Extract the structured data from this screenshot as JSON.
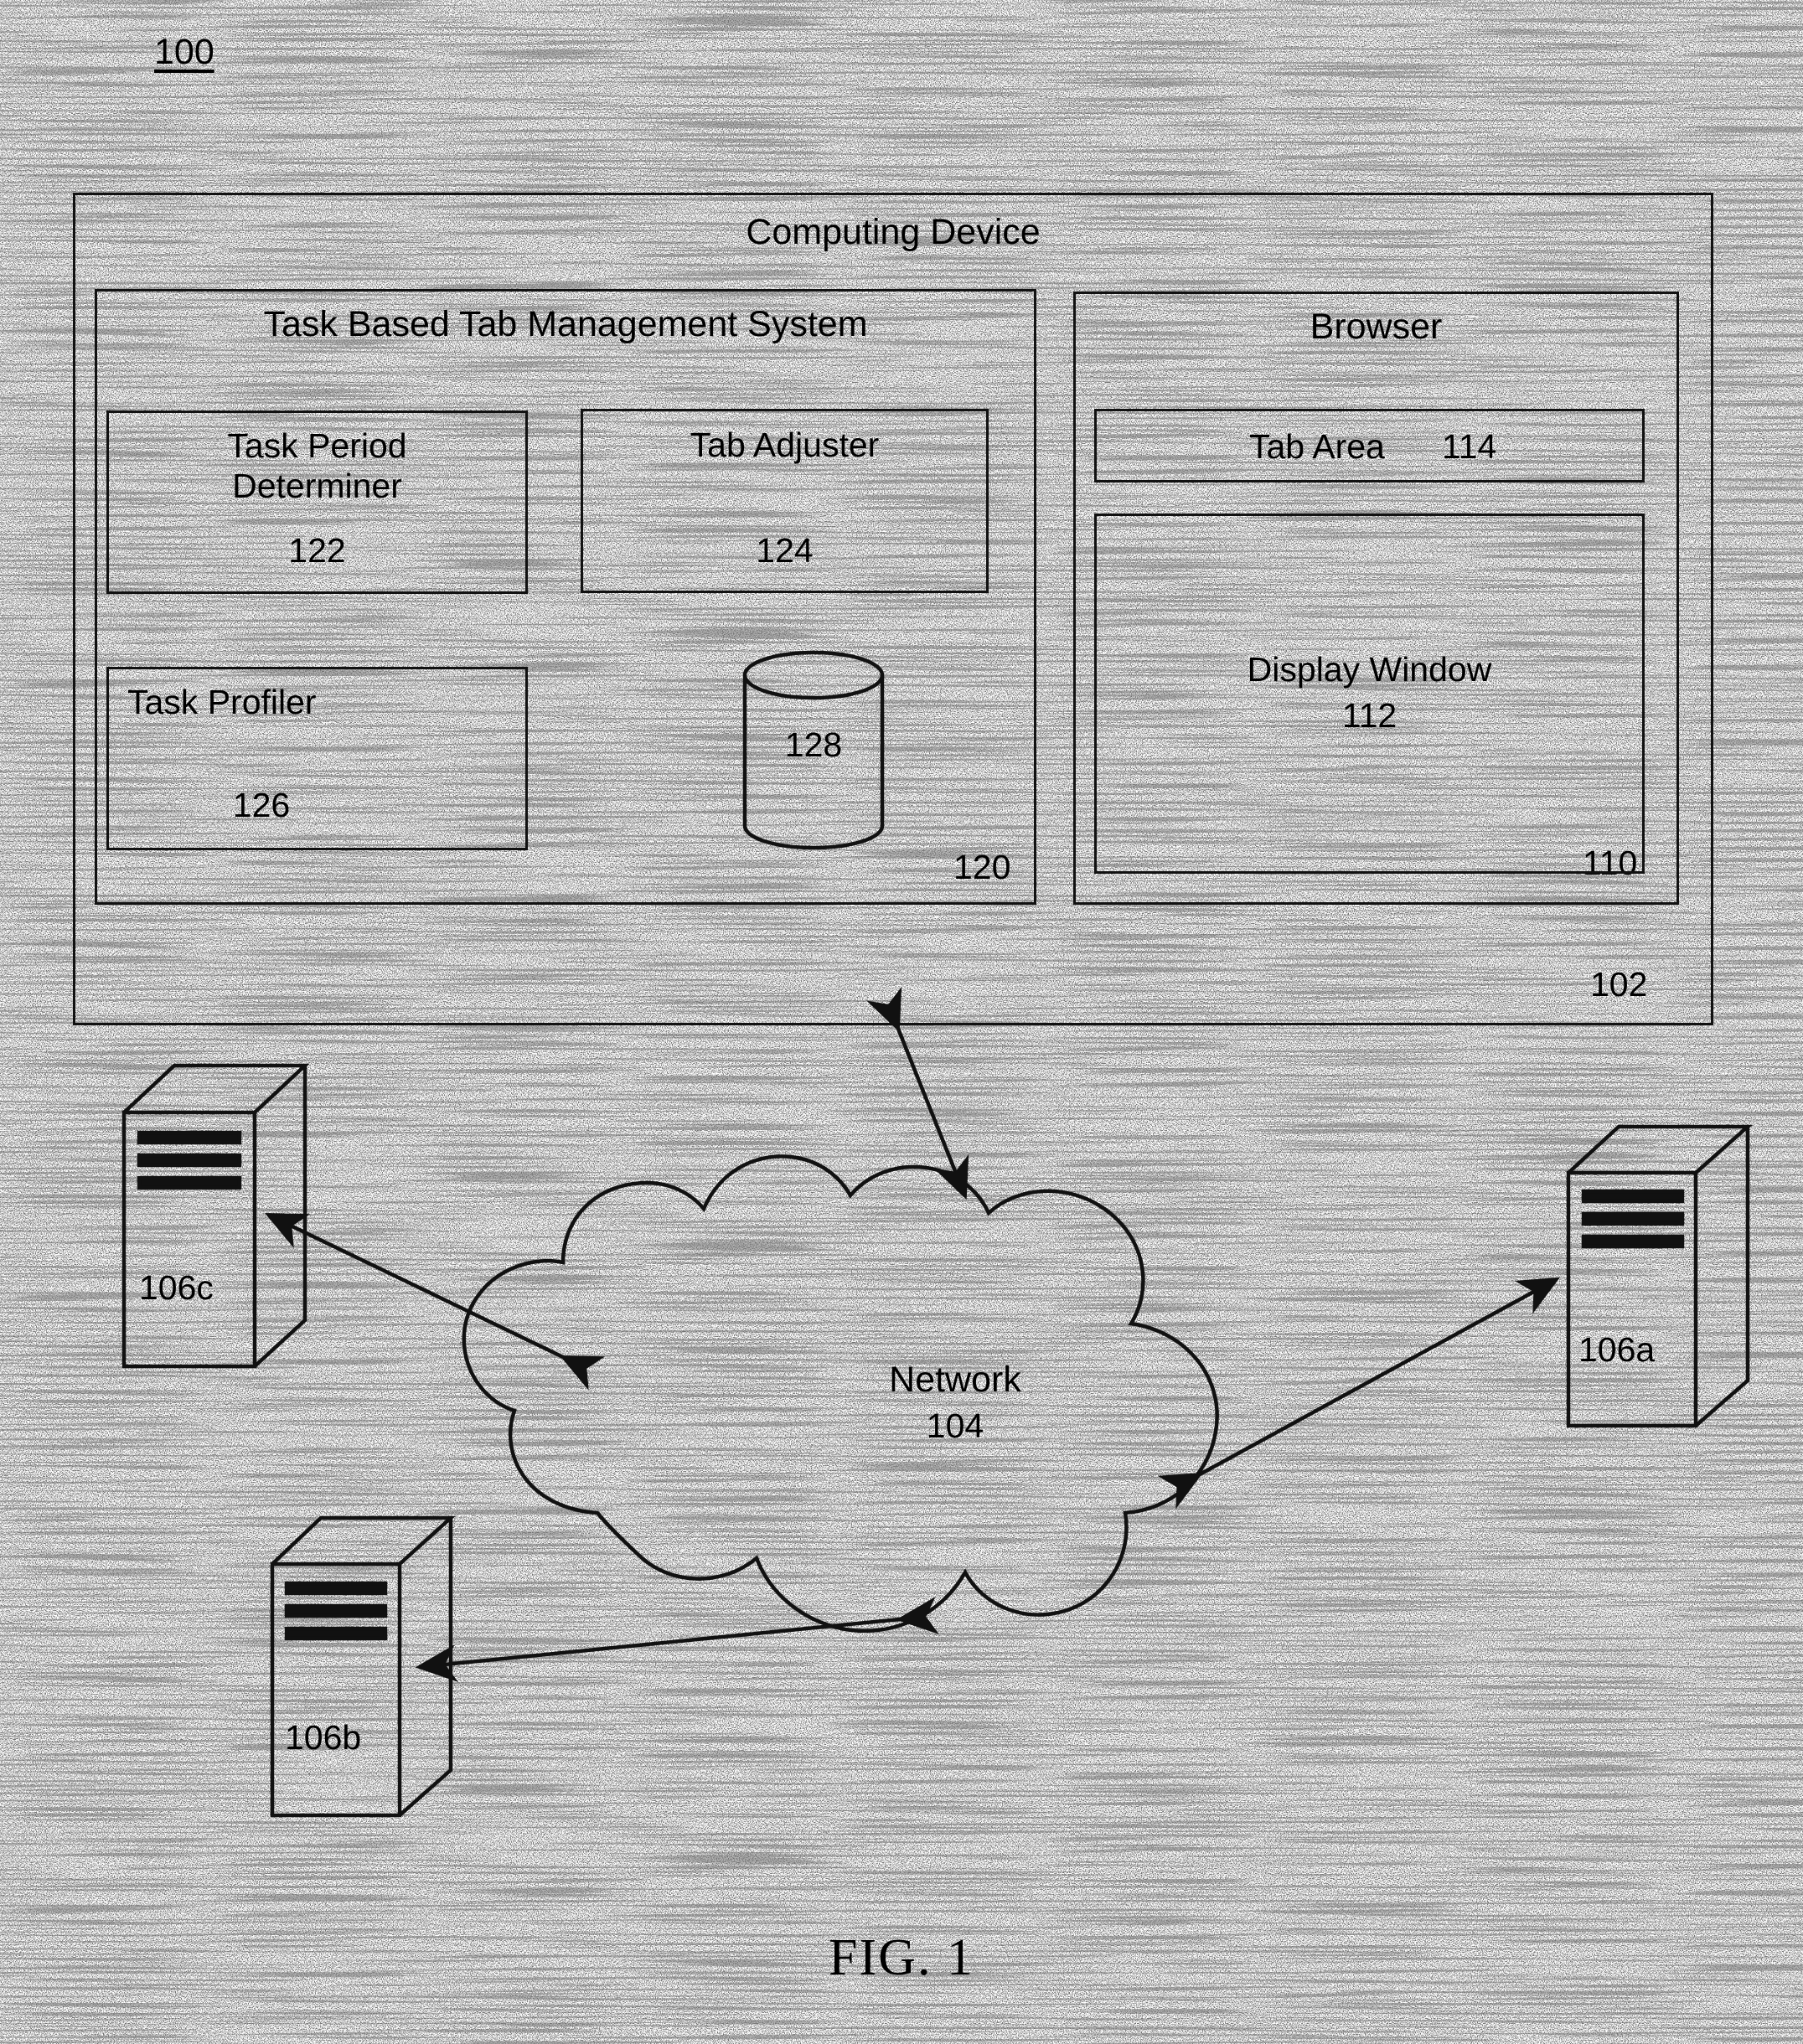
{
  "figure": {
    "number_label": "100",
    "caption": "FIG. 1"
  },
  "computing_device": {
    "title": "Computing Device",
    "ref": "102"
  },
  "tbtms": {
    "title": "Task Based Tab Management System",
    "ref": "120",
    "modules": [
      {
        "name": "Task Period\nDeterminer",
        "ref": "122"
      },
      {
        "name": "Tab Adjuster",
        "ref": "124"
      },
      {
        "name": "Task Profiler",
        "ref": "126"
      }
    ],
    "datastore": {
      "icon": "database-cylinder-icon",
      "ref": "128"
    }
  },
  "browser": {
    "title": "Browser",
    "ref": "110",
    "tab_area": {
      "label": "Tab Area",
      "ref": "114"
    },
    "display_window": {
      "label": "Display Window",
      "ref": "112"
    }
  },
  "network": {
    "label": "Network",
    "ref": "104",
    "icon": "cloud-icon"
  },
  "servers": [
    {
      "ref": "106a",
      "icon": "server-tower-icon"
    },
    {
      "ref": "106b",
      "icon": "server-tower-icon"
    },
    {
      "ref": "106c",
      "icon": "server-tower-icon"
    }
  ],
  "connections": [
    {
      "from": "computing-device",
      "to": "network",
      "style": "double-arrow"
    },
    {
      "from": "network",
      "to": "server-106c",
      "style": "double-arrow"
    },
    {
      "from": "network",
      "to": "server-106a",
      "style": "double-arrow"
    },
    {
      "from": "network",
      "to": "server-106b",
      "style": "double-arrow"
    }
  ]
}
